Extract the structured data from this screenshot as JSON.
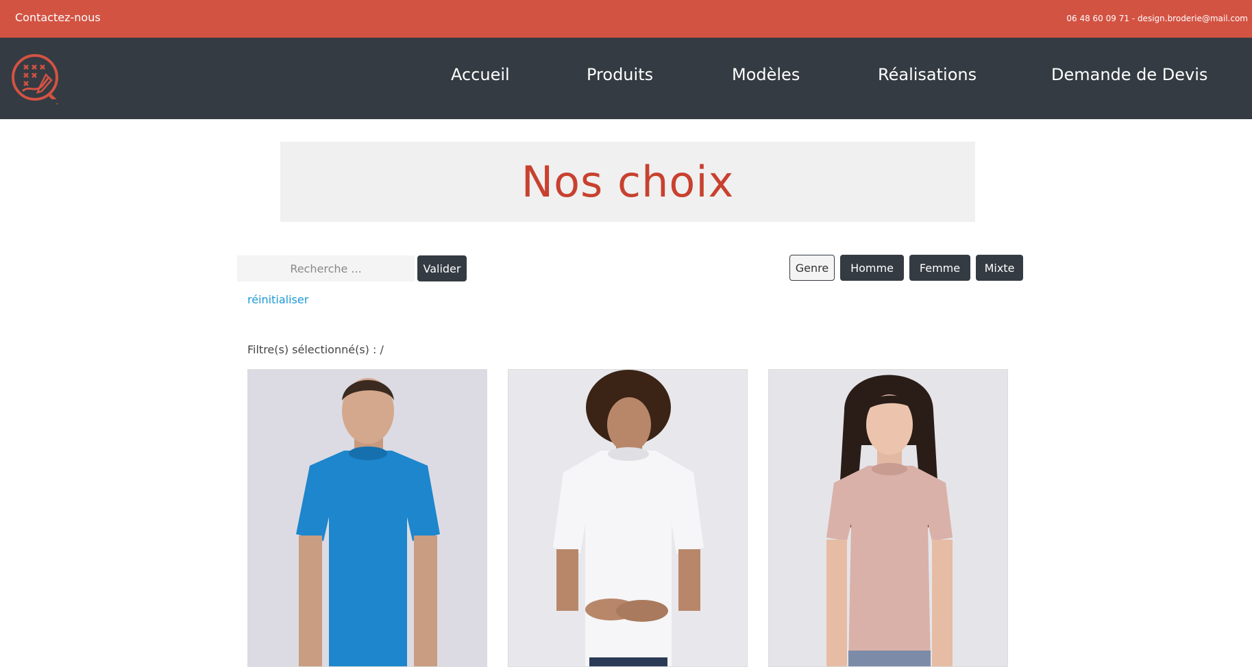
{
  "topbar": {
    "contact_label": "Contactez-nous",
    "contact_info": "06 48 60 09 71 - design.broderie@mail.com"
  },
  "nav": {
    "items": [
      {
        "label": "Accueil"
      },
      {
        "label": "Produits"
      },
      {
        "label": "Modèles"
      },
      {
        "label": "Réalisations"
      },
      {
        "label": "Demande de Devis"
      }
    ]
  },
  "hero": {
    "title": "Nos choix"
  },
  "search": {
    "placeholder": "Recherche ...",
    "submit_label": "Valider",
    "reset_label": "réinitialiser"
  },
  "filters": {
    "group_label": "Genre",
    "options": [
      {
        "label": "Homme"
      },
      {
        "label": "Femme"
      },
      {
        "label": "Mixte"
      }
    ],
    "selected_label": "Filtre(s) sélectionné(s) : /"
  },
  "products": [
    {
      "shirt_color": "#1d86cc"
    },
    {
      "shirt_color": "#f5f5f7"
    },
    {
      "shirt_color": "#d9b1a8"
    }
  ],
  "colors": {
    "topbar": "#d35343",
    "navbar": "#343b42",
    "accent": "#c8412f",
    "link": "#1b98d6"
  }
}
